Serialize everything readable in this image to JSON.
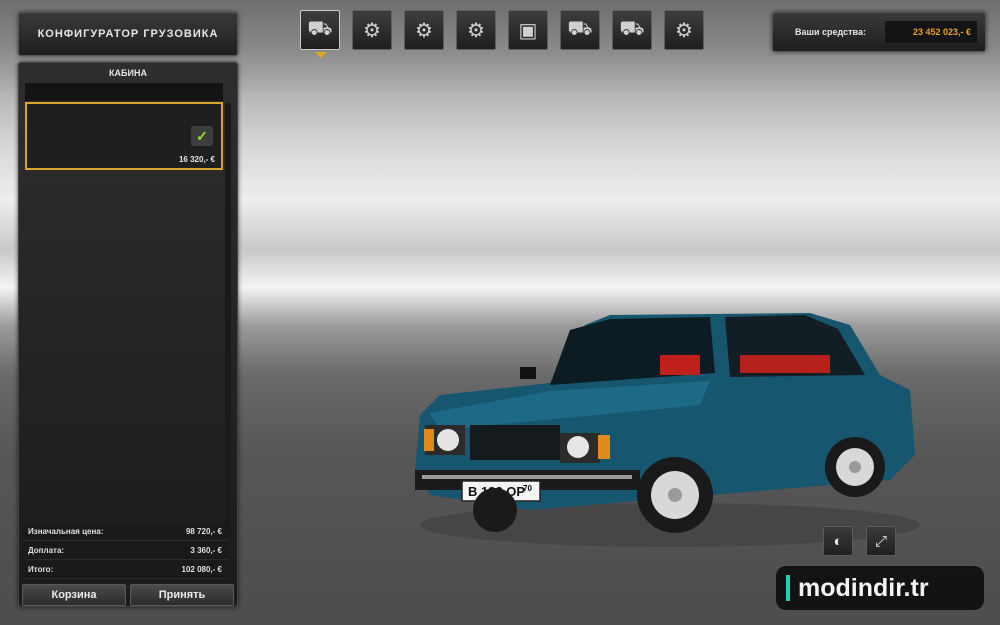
{
  "header": {
    "title": "КОНФИГУРАТОР ГРУЗОВИКА"
  },
  "sidebar": {
    "section_label": "КАБИНА",
    "selected_item": {
      "price": "16 320,- €",
      "selected": true
    },
    "summary": [
      {
        "label": "Изначальная цена:",
        "value": "98 720,- €"
      },
      {
        "label": "Доплата:",
        "value": "3 360,- €"
      },
      {
        "label": "Итого:",
        "value": "102 080,- €"
      }
    ],
    "buttons": {
      "cart": "Корзина",
      "accept": "Принять"
    }
  },
  "tabs": [
    {
      "icon": "cabin-icon",
      "active": true
    },
    {
      "icon": "chassis-icon",
      "active": false
    },
    {
      "icon": "engine-icon",
      "active": false
    },
    {
      "icon": "transmission-icon",
      "active": false
    },
    {
      "icon": "interior-icon",
      "active": false
    },
    {
      "icon": "truck-front-icon",
      "active": false
    },
    {
      "icon": "accessories-icon",
      "active": false
    },
    {
      "icon": "paint-icon",
      "active": false
    }
  ],
  "funds": {
    "label": "Ваши средства:",
    "value": "23 452 023,- €"
  },
  "vehicle": {
    "plate": "В 132 ОР",
    "region": "70",
    "color": "#16566f"
  },
  "controls": {
    "lights": "lights-icon",
    "fullscreen": "fullscreen-icon"
  },
  "watermark": {
    "text": "modindir.tr",
    "accent": "#1fd0b4"
  }
}
